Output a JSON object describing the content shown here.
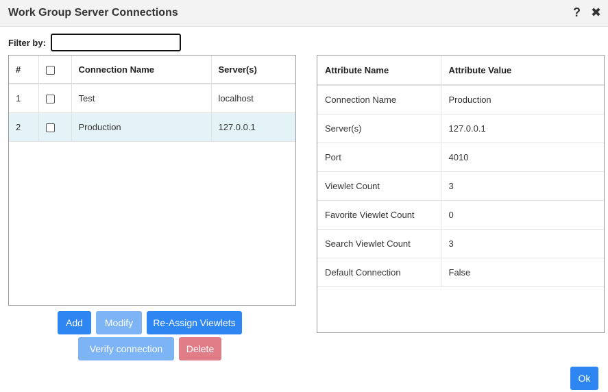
{
  "dialog": {
    "title": "Work Group Server Connections",
    "help_icon": "?",
    "close_icon": "✖"
  },
  "filter": {
    "label": "Filter by:",
    "value": ""
  },
  "connections": {
    "headers": [
      "#",
      "",
      "Connection Name",
      "Server(s)"
    ],
    "rows": [
      {
        "num": "1",
        "name": "Test",
        "servers": "localhost",
        "selected": false
      },
      {
        "num": "2",
        "name": "Production",
        "servers": "127.0.0.1",
        "selected": true
      }
    ]
  },
  "attributes": {
    "headers": [
      "Attribute Name",
      "Attribute Value"
    ],
    "rows": [
      {
        "name": "Connection Name",
        "value": "Production"
      },
      {
        "name": "Server(s)",
        "value": "127.0.0.1"
      },
      {
        "name": "Port",
        "value": "4010"
      },
      {
        "name": "Viewlet Count",
        "value": "3"
      },
      {
        "name": "Favorite Viewlet Count",
        "value": "0"
      },
      {
        "name": "Search Viewlet Count",
        "value": "3"
      },
      {
        "name": "Default Connection",
        "value": "False"
      }
    ]
  },
  "buttons": {
    "add": "Add",
    "modify": "Modify",
    "reassign": "Re-Assign Viewlets",
    "verify": "Verify connection",
    "delete": "Delete",
    "ok": "Ok"
  },
  "colors": {
    "primary": "#2e86f3",
    "disabled": "#7db4f5",
    "danger": "#e07d87",
    "selected_row": "#e4f3f8"
  }
}
